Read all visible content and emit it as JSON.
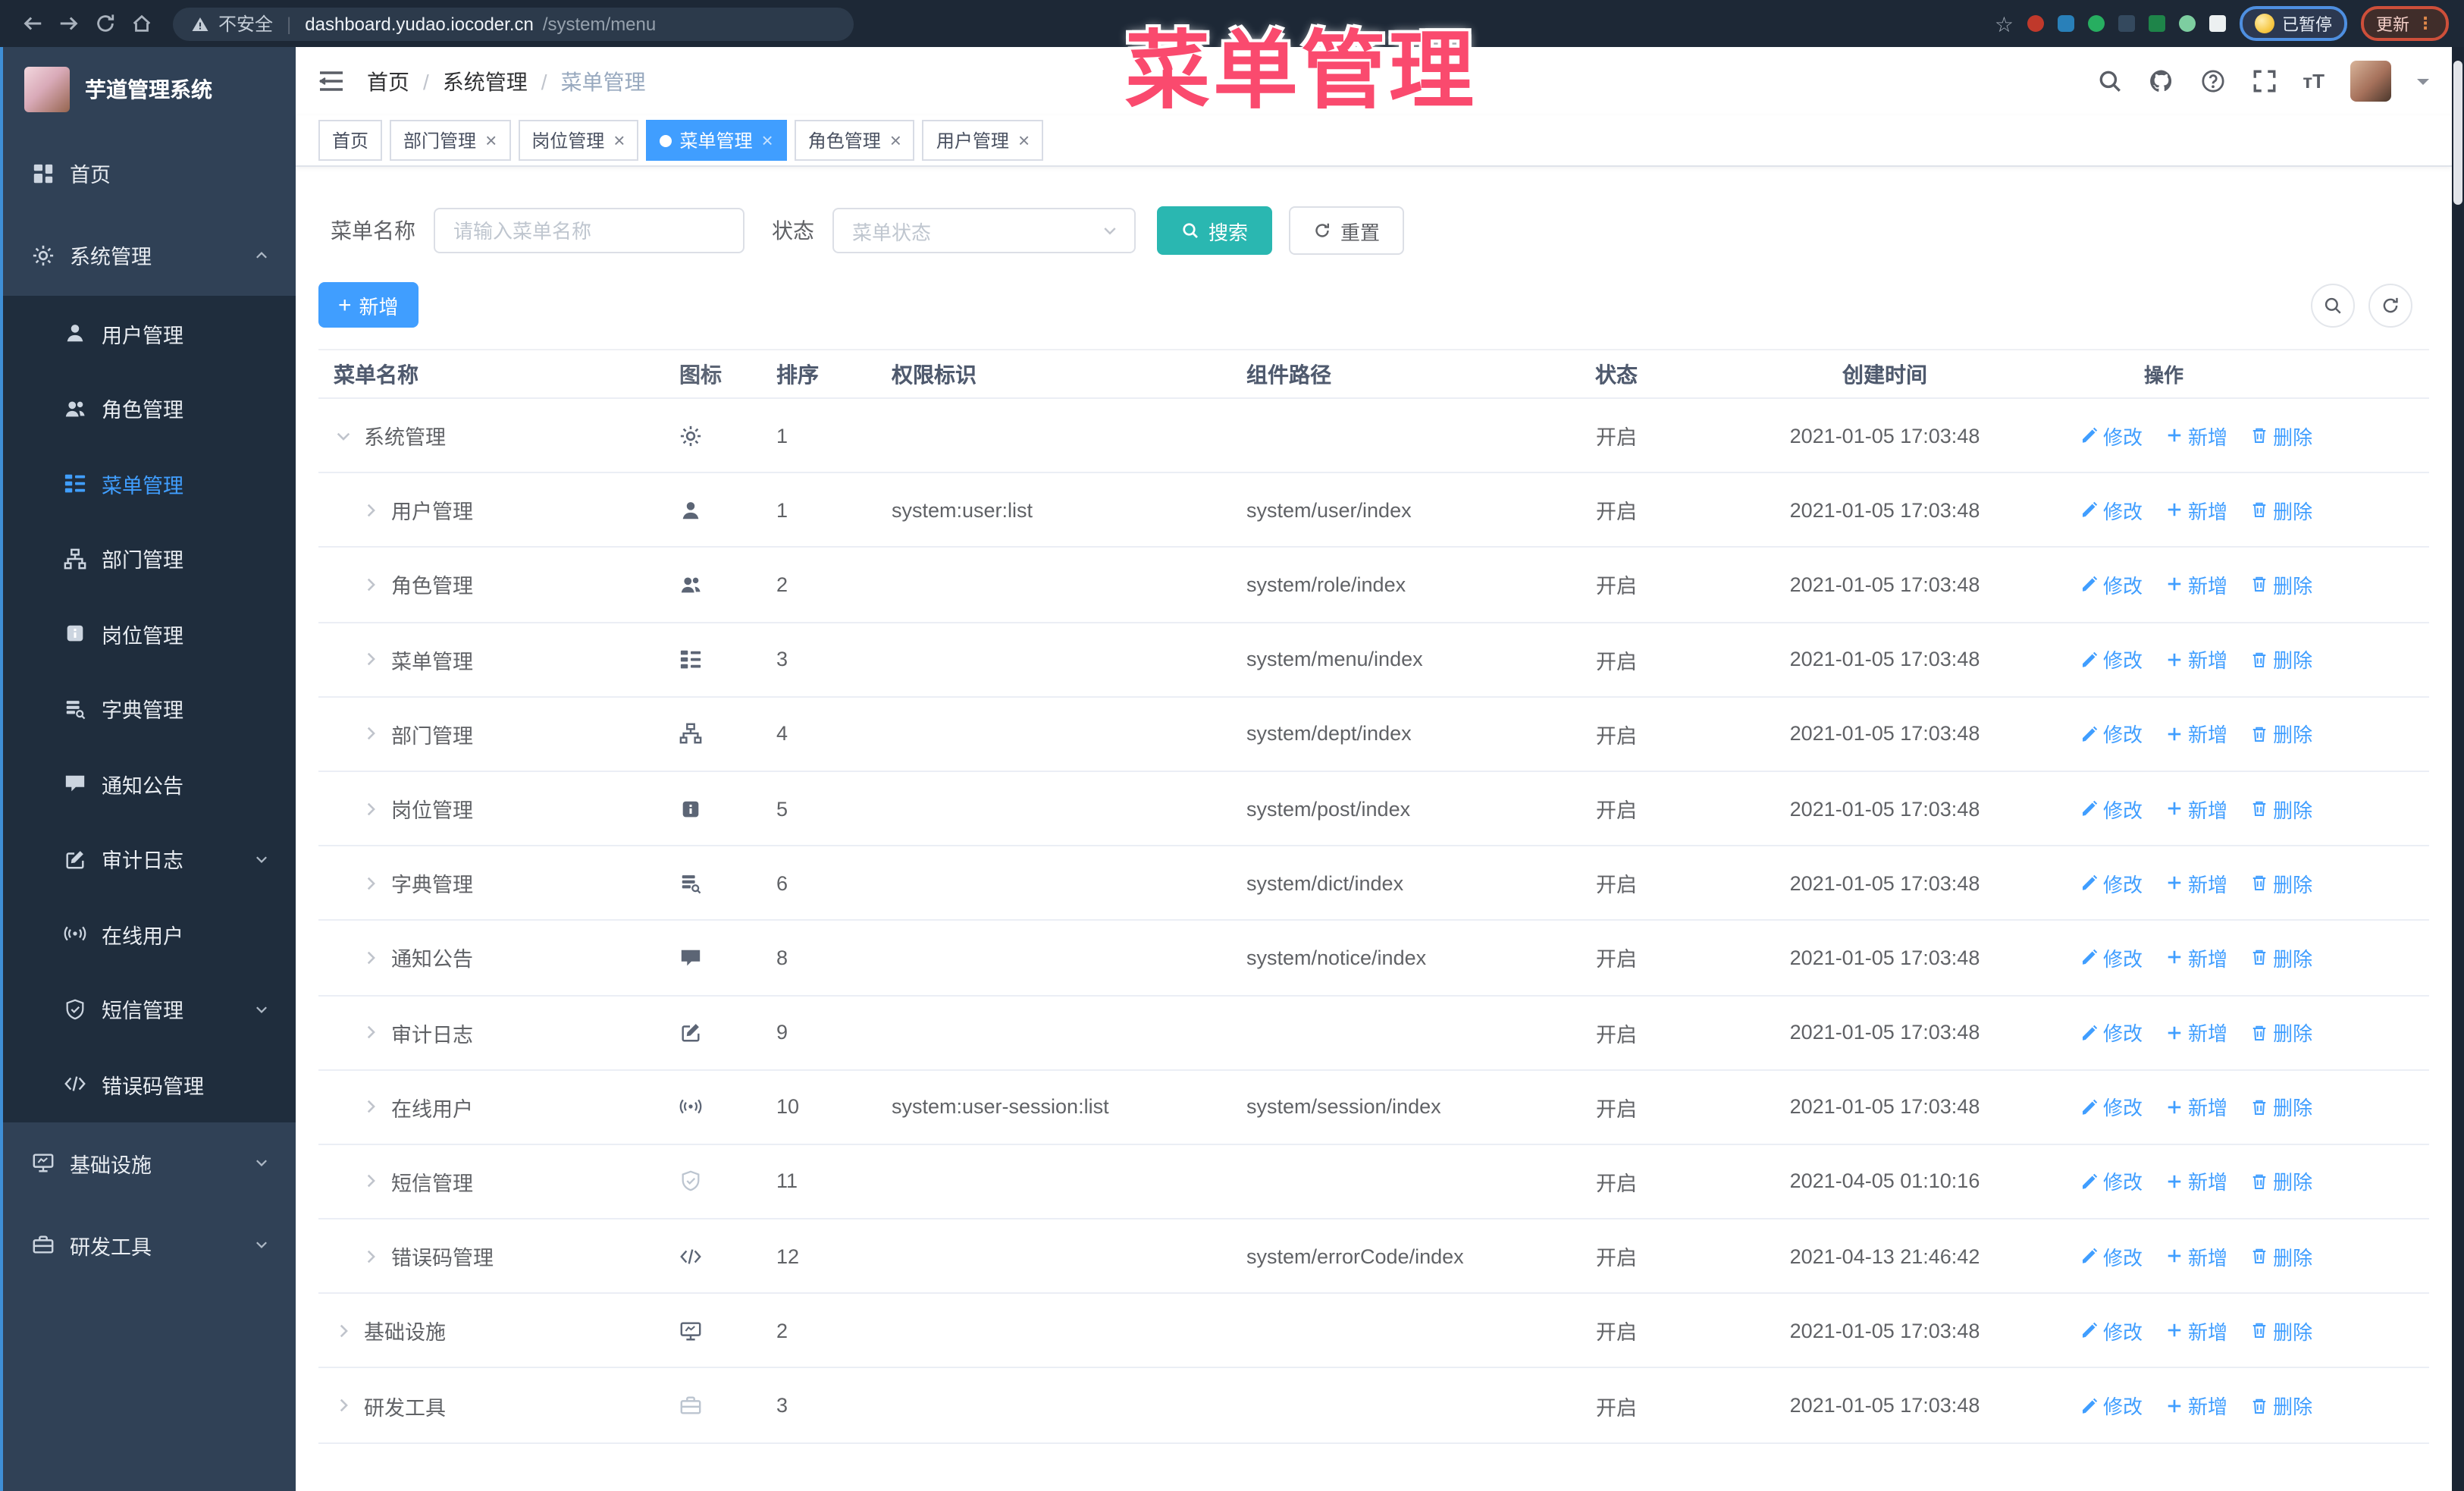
{
  "overlay": {
    "title": "菜单管理"
  },
  "colors": {
    "primary": "#409EFF",
    "teal": "#2ab7b1",
    "pink": "#fa4a6e",
    "sidebar_bg": "#304156",
    "submenu_bg": "#1f2d3d"
  },
  "browser": {
    "security_label": "不安全",
    "url_host": "dashboard.yudao.iocoder.cn",
    "url_path": "/system/menu",
    "paused_badge": "已暂停",
    "update_button": "更新"
  },
  "sidebar": {
    "app_title": "芋道管理系统",
    "items": [
      {
        "label": "首页",
        "icon": "dashboard-icon",
        "level": 0
      },
      {
        "label": "系统管理",
        "icon": "gear-icon",
        "level": 0,
        "chevron": "up"
      },
      {
        "label": "用户管理",
        "icon": "user-icon",
        "level": 1
      },
      {
        "label": "角色管理",
        "icon": "users-icon",
        "level": 1
      },
      {
        "label": "菜单管理",
        "icon": "tree-table-icon",
        "level": 1,
        "active": true
      },
      {
        "label": "部门管理",
        "icon": "org-icon",
        "level": 1
      },
      {
        "label": "岗位管理",
        "icon": "post-icon",
        "level": 1
      },
      {
        "label": "字典管理",
        "icon": "dict-icon",
        "level": 1
      },
      {
        "label": "通知公告",
        "icon": "message-icon",
        "level": 1
      },
      {
        "label": "审计日志",
        "icon": "edit-icon",
        "level": 1,
        "chevron": "down"
      },
      {
        "label": "在线用户",
        "icon": "online-icon",
        "level": 1
      },
      {
        "label": "短信管理",
        "icon": "shield-icon",
        "level": 1,
        "chevron": "down"
      },
      {
        "label": "错误码管理",
        "icon": "code-icon",
        "level": 1
      },
      {
        "label": "基础设施",
        "icon": "monitor-icon",
        "level": 0,
        "chevron": "down"
      },
      {
        "label": "研发工具",
        "icon": "toolbox-icon",
        "level": 0,
        "chevron": "down"
      }
    ]
  },
  "header": {
    "breadcrumb": [
      "首页",
      "系统管理",
      "菜单管理"
    ]
  },
  "tabs": [
    {
      "label": "首页",
      "closable": false,
      "active": false
    },
    {
      "label": "部门管理",
      "closable": true,
      "active": false
    },
    {
      "label": "岗位管理",
      "closable": true,
      "active": false
    },
    {
      "label": "菜单管理",
      "closable": true,
      "active": true
    },
    {
      "label": "角色管理",
      "closable": true,
      "active": false
    },
    {
      "label": "用户管理",
      "closable": true,
      "active": false
    }
  ],
  "filters": {
    "name_label": "菜单名称",
    "name_placeholder": "请输入菜单名称",
    "name_value": "",
    "status_label": "状态",
    "status_placeholder": "菜单状态",
    "search_label": "搜索",
    "reset_label": "重置"
  },
  "toolbar": {
    "add_label": "新增"
  },
  "table": {
    "columns": [
      "菜单名称",
      "图标",
      "排序",
      "权限标识",
      "组件路径",
      "状态",
      "创建时间",
      "操作"
    ],
    "actions": {
      "edit": "修改",
      "add": "新增",
      "delete": "删除"
    },
    "rows": [
      {
        "name": "系统管理",
        "icon": "gear-icon",
        "level": 0,
        "expanded": true,
        "sort": "1",
        "perm": "",
        "path": "",
        "status": "开启",
        "time": "2021-01-05 17:03:48"
      },
      {
        "name": "用户管理",
        "icon": "user-icon",
        "level": 1,
        "expanded": false,
        "sort": "1",
        "perm": "system:user:list",
        "path": "system/user/index",
        "status": "开启",
        "time": "2021-01-05 17:03:48"
      },
      {
        "name": "角色管理",
        "icon": "users-icon",
        "level": 1,
        "expanded": false,
        "sort": "2",
        "perm": "",
        "path": "system/role/index",
        "status": "开启",
        "time": "2021-01-05 17:03:48"
      },
      {
        "name": "菜单管理",
        "icon": "tree-table-icon",
        "level": 1,
        "expanded": false,
        "sort": "3",
        "perm": "",
        "path": "system/menu/index",
        "status": "开启",
        "time": "2021-01-05 17:03:48"
      },
      {
        "name": "部门管理",
        "icon": "org-icon",
        "level": 1,
        "expanded": false,
        "sort": "4",
        "perm": "",
        "path": "system/dept/index",
        "status": "开启",
        "time": "2021-01-05 17:03:48"
      },
      {
        "name": "岗位管理",
        "icon": "post-icon",
        "level": 1,
        "expanded": false,
        "sort": "5",
        "perm": "",
        "path": "system/post/index",
        "status": "开启",
        "time": "2021-01-05 17:03:48"
      },
      {
        "name": "字典管理",
        "icon": "dict-icon",
        "level": 1,
        "expanded": false,
        "sort": "6",
        "perm": "",
        "path": "system/dict/index",
        "status": "开启",
        "time": "2021-01-05 17:03:48"
      },
      {
        "name": "通知公告",
        "icon": "message-icon",
        "level": 1,
        "expanded": false,
        "sort": "8",
        "perm": "",
        "path": "system/notice/index",
        "status": "开启",
        "time": "2021-01-05 17:03:48"
      },
      {
        "name": "审计日志",
        "icon": "edit-icon",
        "level": 1,
        "expanded": false,
        "sort": "9",
        "perm": "",
        "path": "",
        "status": "开启",
        "time": "2021-01-05 17:03:48"
      },
      {
        "name": "在线用户",
        "icon": "online-icon",
        "level": 1,
        "expanded": false,
        "sort": "10",
        "perm": "system:user-session:list",
        "path": "system/session/index",
        "status": "开启",
        "time": "2021-01-05 17:03:48"
      },
      {
        "name": "短信管理",
        "icon": "shield-icon",
        "level": 1,
        "expanded": false,
        "sort": "11",
        "perm": "",
        "path": "",
        "status": "开启",
        "time": "2021-04-05 01:10:16",
        "muted": true
      },
      {
        "name": "错误码管理",
        "icon": "code-icon",
        "level": 1,
        "expanded": false,
        "sort": "12",
        "perm": "",
        "path": "system/errorCode/index",
        "status": "开启",
        "time": "2021-04-13 21:46:42"
      },
      {
        "name": "基础设施",
        "icon": "monitor-icon",
        "level": 0,
        "expanded": false,
        "sort": "2",
        "perm": "",
        "path": "",
        "status": "开启",
        "time": "2021-01-05 17:03:48"
      },
      {
        "name": "研发工具",
        "icon": "toolbox-icon",
        "level": 0,
        "expanded": false,
        "sort": "3",
        "perm": "",
        "path": "",
        "status": "开启",
        "time": "2021-01-05 17:03:48",
        "muted": true
      }
    ]
  }
}
